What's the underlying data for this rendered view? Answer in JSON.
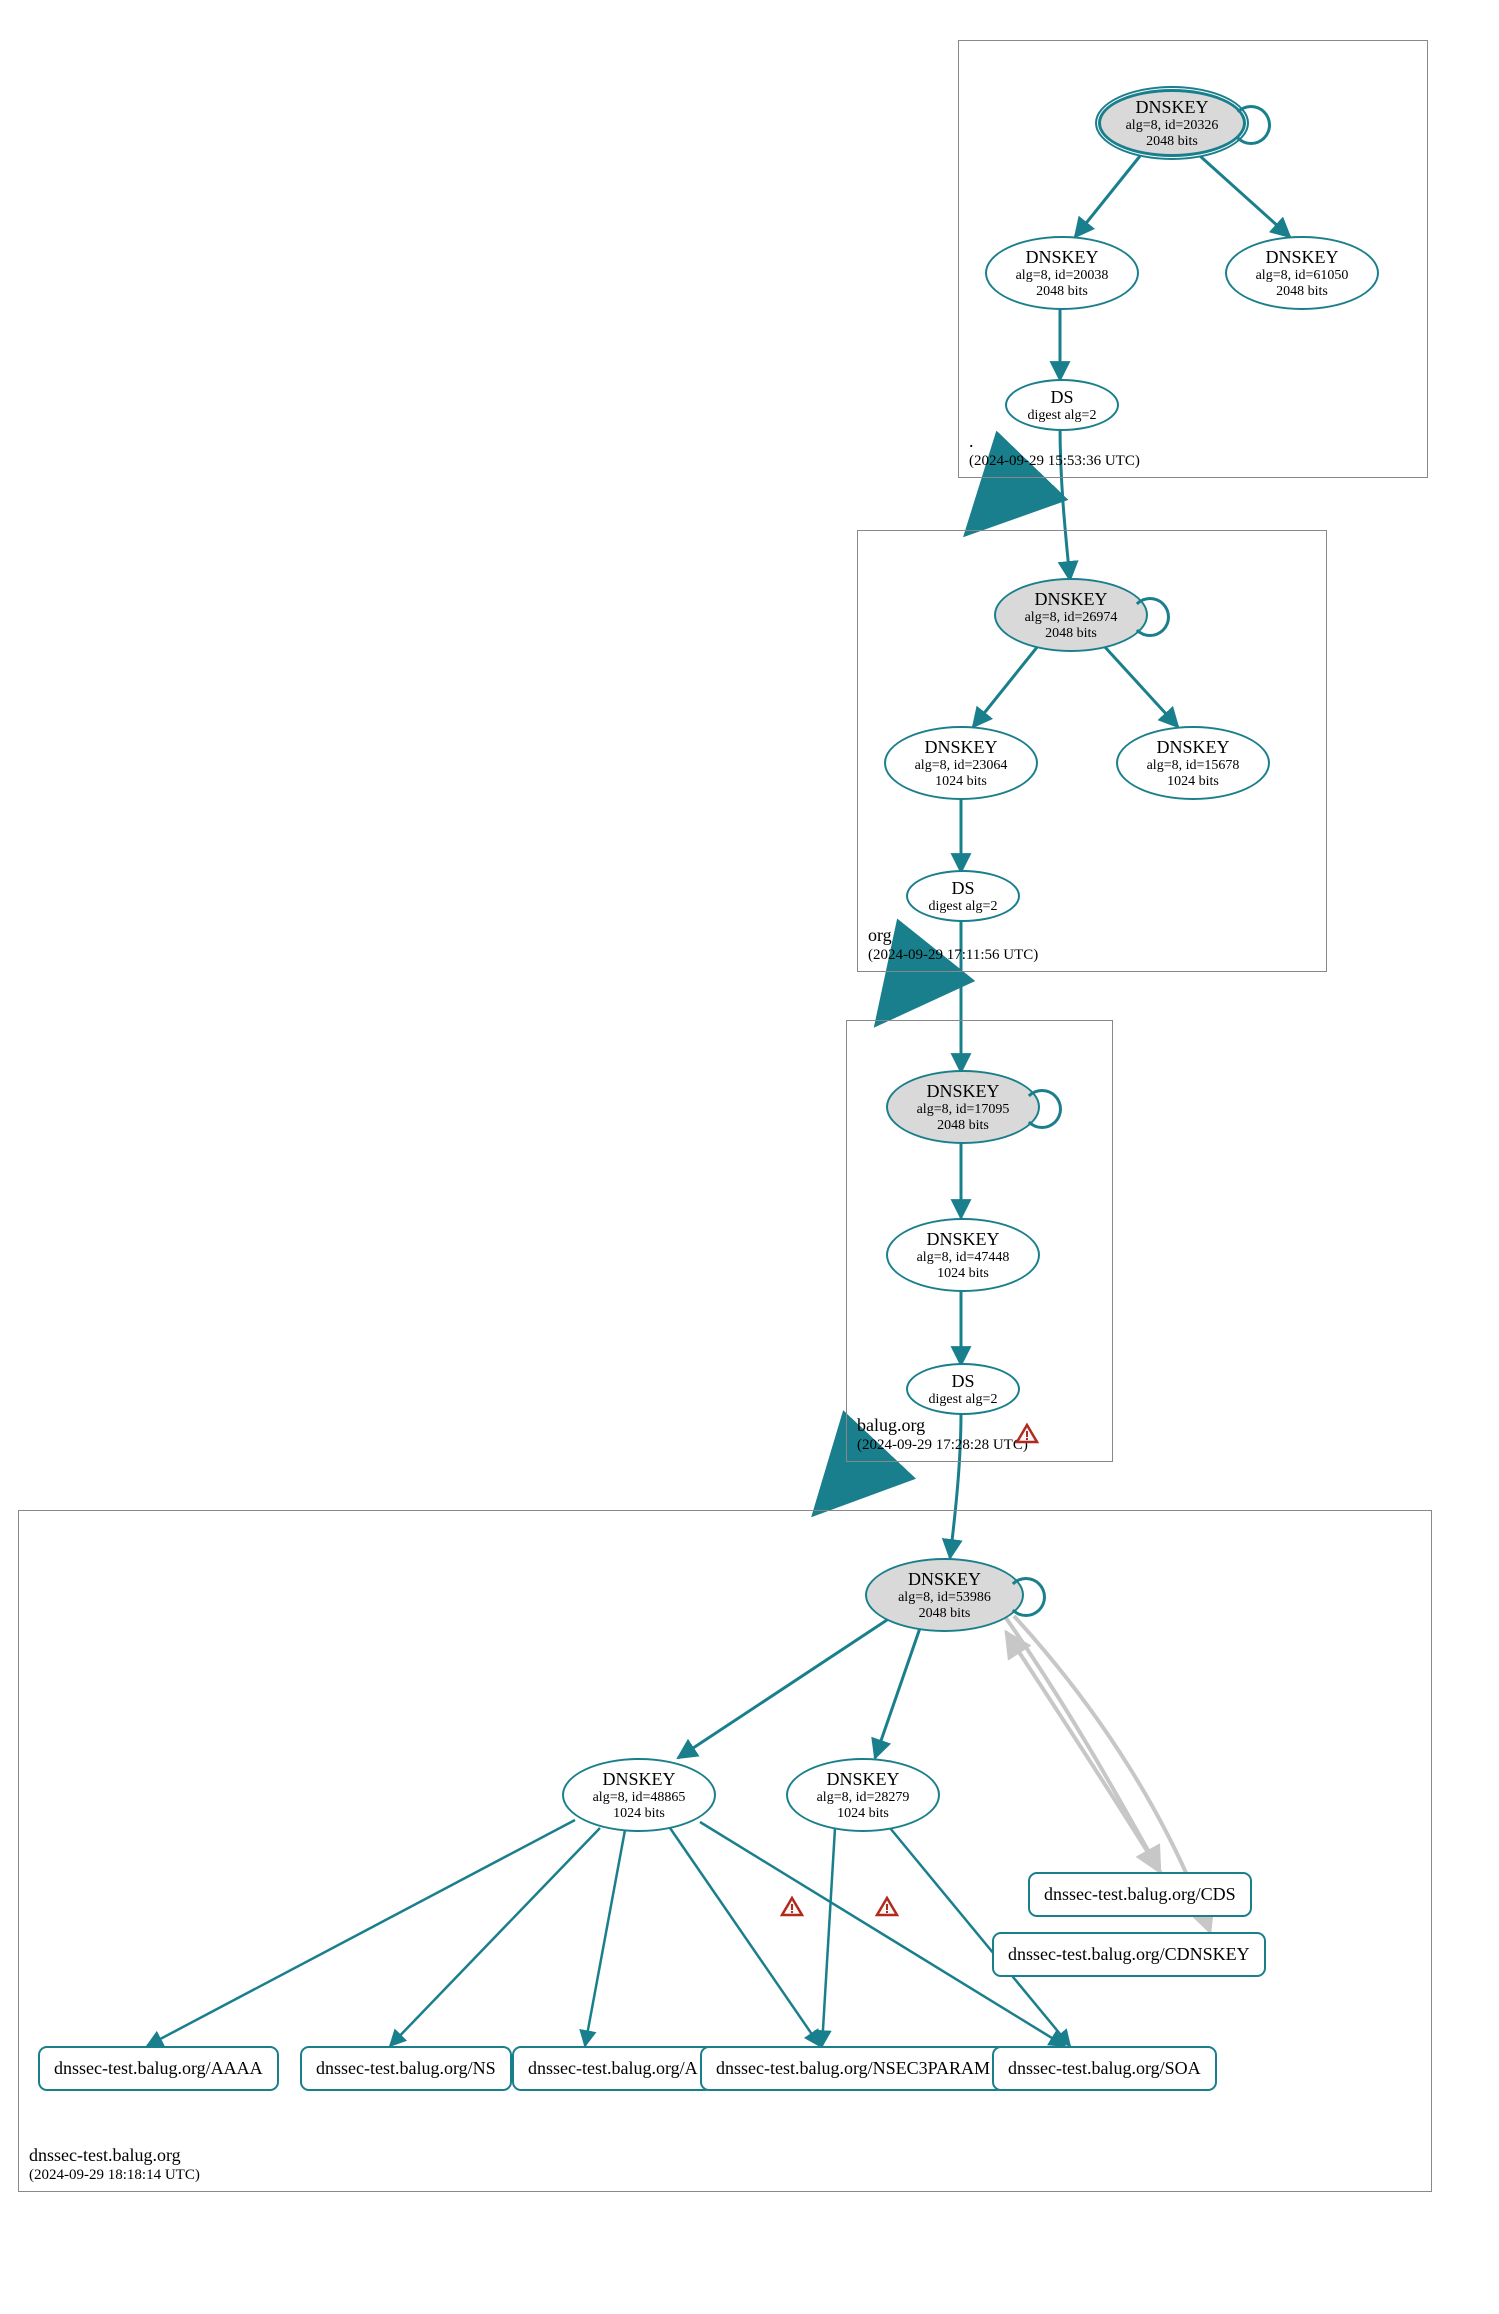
{
  "zones": {
    "root": {
      "name": ".",
      "timestamp": "(2024-09-29 15:53:36 UTC)"
    },
    "org": {
      "name": "org",
      "timestamp": "(2024-09-29 17:11:56 UTC)"
    },
    "balug": {
      "name": "balug.org",
      "timestamp": "(2024-09-29 17:28:28 UTC)"
    },
    "test": {
      "name": "dnssec-test.balug.org",
      "timestamp": "(2024-09-29 18:18:14 UTC)"
    }
  },
  "nodes": {
    "root_ksk": {
      "title": "DNSKEY",
      "sub1": "alg=8, id=20326",
      "sub2": "2048 bits"
    },
    "root_zsk1": {
      "title": "DNSKEY",
      "sub1": "alg=8, id=20038",
      "sub2": "2048 bits"
    },
    "root_zsk2": {
      "title": "DNSKEY",
      "sub1": "alg=8, id=61050",
      "sub2": "2048 bits"
    },
    "root_ds": {
      "title": "DS",
      "sub1": "digest alg=2"
    },
    "org_ksk": {
      "title": "DNSKEY",
      "sub1": "alg=8, id=26974",
      "sub2": "2048 bits"
    },
    "org_zsk1": {
      "title": "DNSKEY",
      "sub1": "alg=8, id=23064",
      "sub2": "1024 bits"
    },
    "org_zsk2": {
      "title": "DNSKEY",
      "sub1": "alg=8, id=15678",
      "sub2": "1024 bits"
    },
    "org_ds": {
      "title": "DS",
      "sub1": "digest alg=2"
    },
    "balug_ksk": {
      "title": "DNSKEY",
      "sub1": "alg=8, id=17095",
      "sub2": "2048 bits"
    },
    "balug_zsk": {
      "title": "DNSKEY",
      "sub1": "alg=8, id=47448",
      "sub2": "1024 bits"
    },
    "balug_ds": {
      "title": "DS",
      "sub1": "digest alg=2"
    },
    "test_ksk": {
      "title": "DNSKEY",
      "sub1": "alg=8, id=53986",
      "sub2": "2048 bits"
    },
    "test_zsk1": {
      "title": "DNSKEY",
      "sub1": "alg=8, id=48865",
      "sub2": "1024 bits"
    },
    "test_zsk2": {
      "title": "DNSKEY",
      "sub1": "alg=8, id=28279",
      "sub2": "1024 bits"
    }
  },
  "rr": {
    "aaaa": "dnssec-test.balug.org/AAAA",
    "ns": "dnssec-test.balug.org/NS",
    "a": "dnssec-test.balug.org/A",
    "nsec3": "dnssec-test.balug.org/NSEC3PARAM",
    "soa": "dnssec-test.balug.org/SOA",
    "cds": "dnssec-test.balug.org/CDS",
    "cdnskey": "dnssec-test.balug.org/CDNSKEY"
  },
  "colors": {
    "stroke": "#1a7f8c",
    "ksk_fill": "#d9d9d9",
    "warn_stroke": "#b02a1f",
    "warn_fill": "#f7f7f7",
    "light_stroke": "#c7c7c7"
  }
}
